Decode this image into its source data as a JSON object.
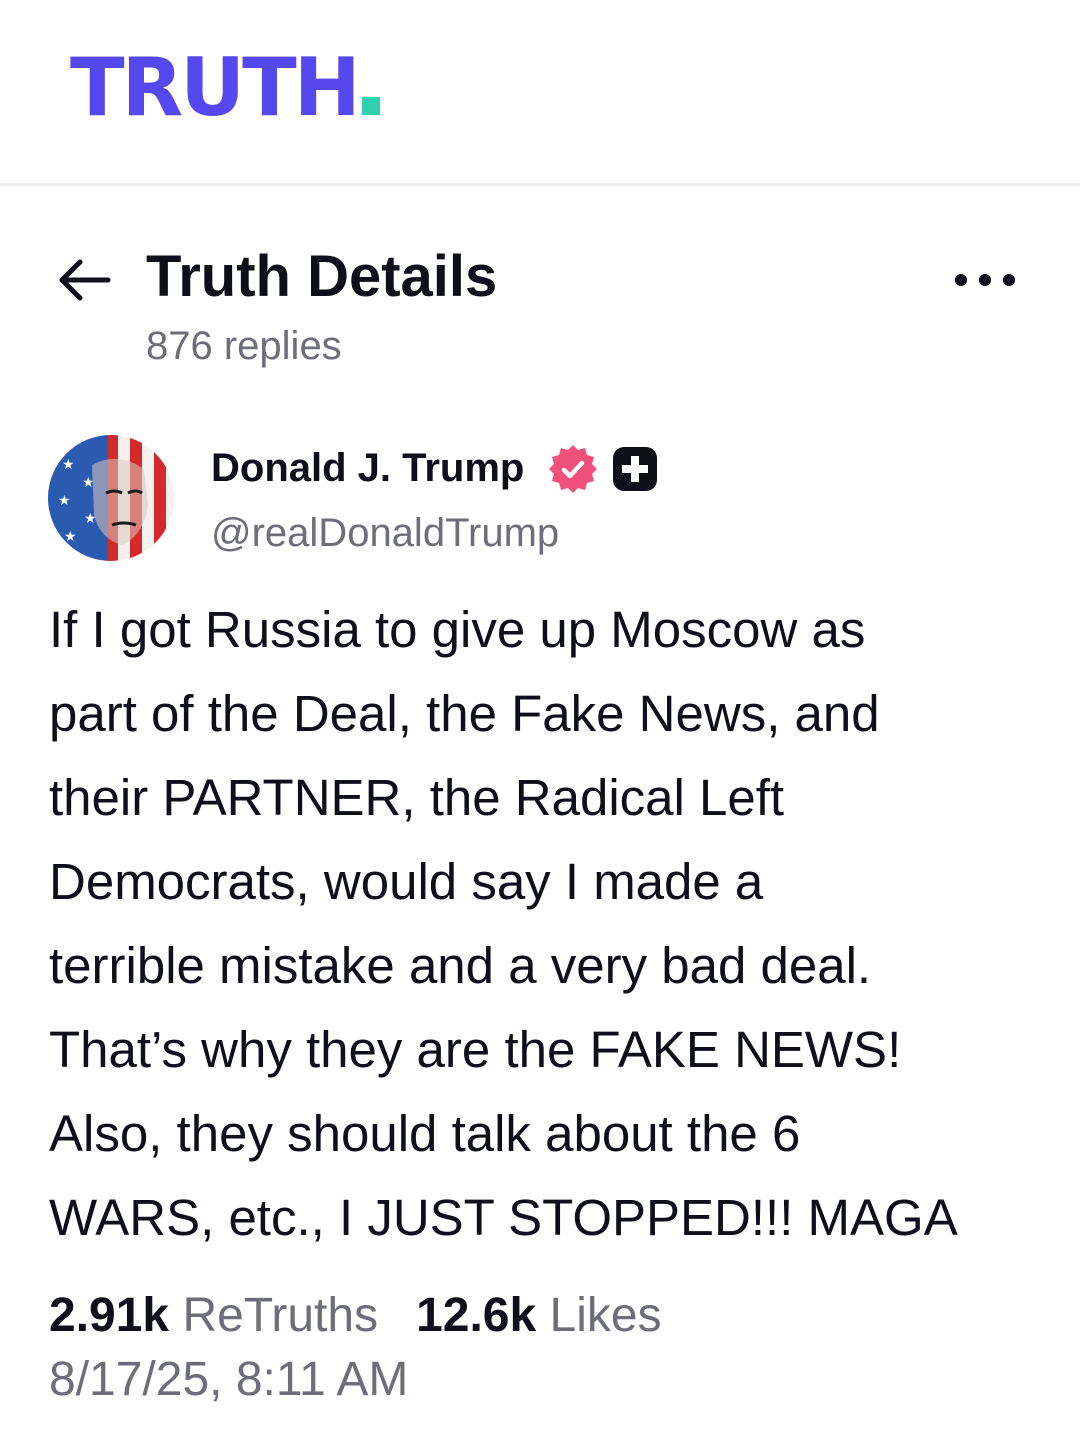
{
  "app": {
    "logo_text": "TRUTH",
    "brand_color": "#5448ee",
    "logo_dot_color": "#2fd0b0"
  },
  "header": {
    "back_icon": "arrow-left-icon",
    "title": "Truth Details",
    "replies": "876 replies",
    "more_icon": "more-horizontal-icon"
  },
  "post": {
    "author": {
      "name": "Donald J. Trump",
      "handle": "@realDonaldTrump",
      "avatar_icon": "flag-portrait-avatar",
      "verified_icon": "verified-badge-icon",
      "verified_color": "#f0507a",
      "plus_icon": "truth-plus-icon"
    },
    "text_lines": [
      "If I got Russia to give up Moscow as",
      "part of the Deal, the Fake News, and",
      "their PARTNER, the Radical Left",
      "Democrats, would say I made a",
      "terrible mistake and a very bad deal.",
      "That’s why they are the FAKE NEWS!",
      "Also, they should talk about the 6",
      "WARS, etc., I JUST STOPPED!!! MAGA"
    ],
    "retruths_count": "2.91k",
    "retruths_label": "ReTruths",
    "likes_count": "12.6k",
    "likes_label": "Likes",
    "timestamp": "8/17/25, 8:11 AM"
  }
}
